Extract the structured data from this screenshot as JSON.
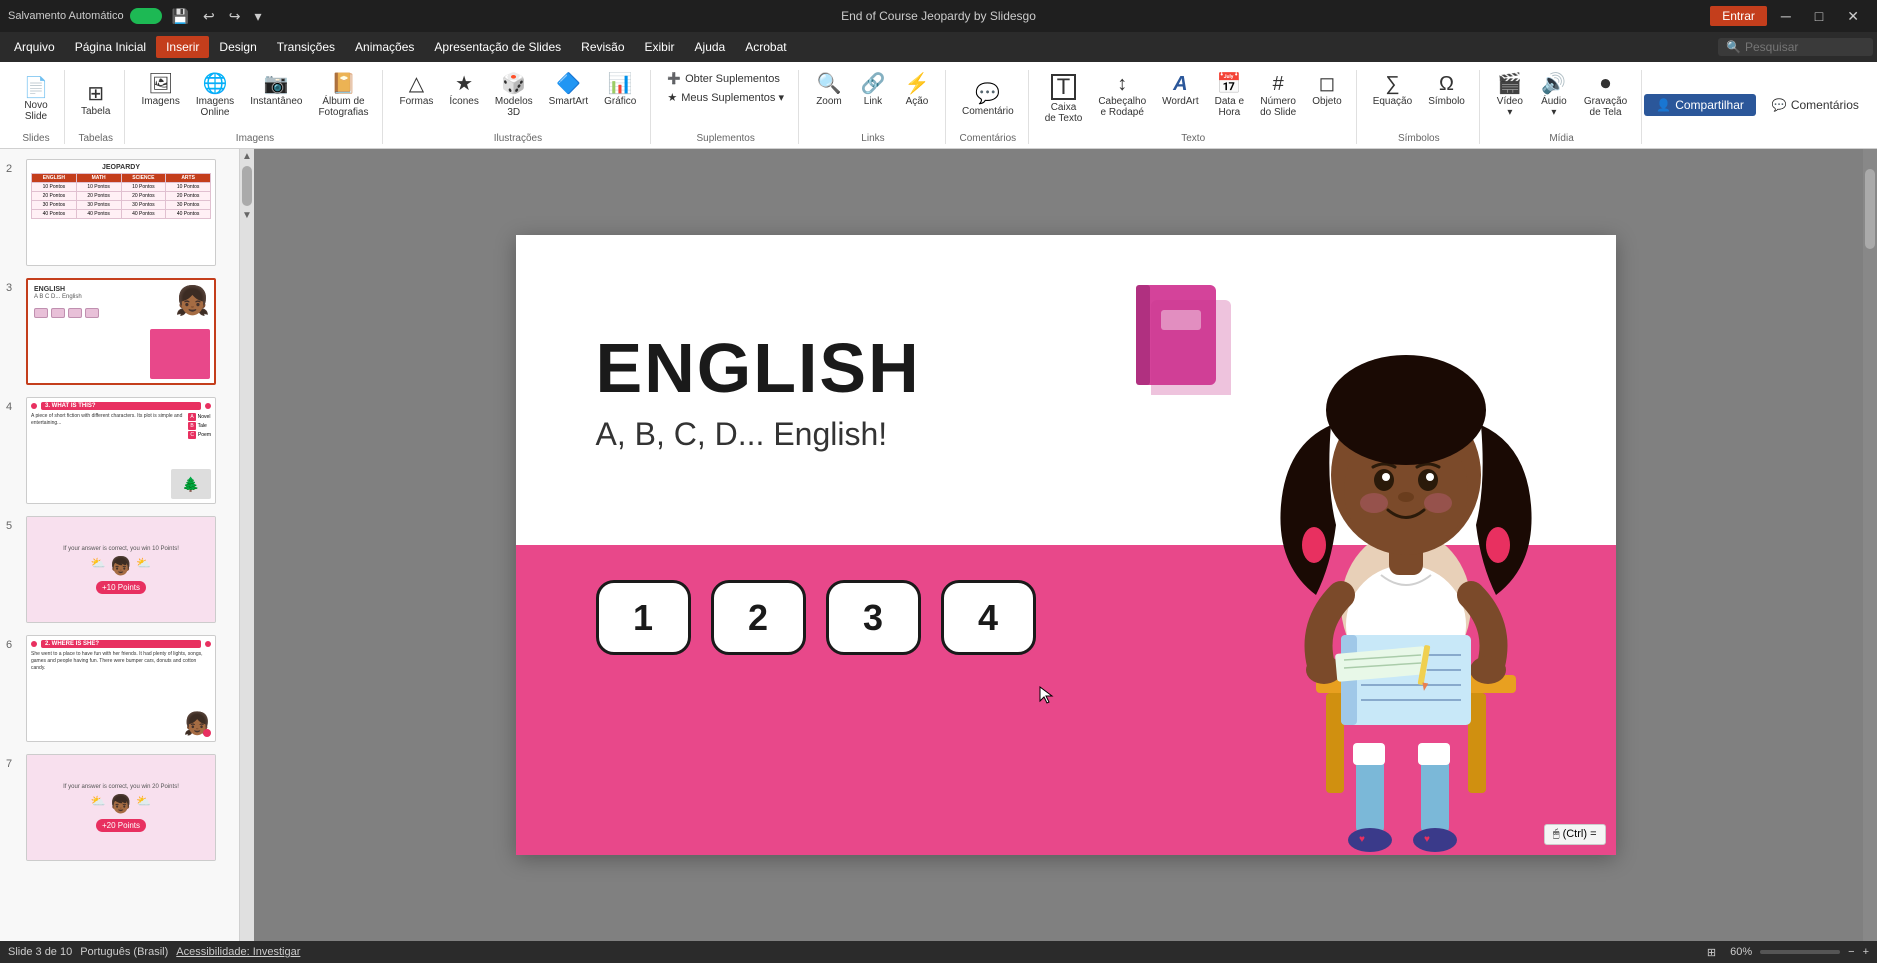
{
  "titlebar": {
    "autosave": "Salvamento Automático",
    "title": "End of Course Jeopardy by Slidesgo",
    "entrar": "Entrar",
    "icons": {
      "save": "💾",
      "undo": "↩",
      "redo": "↪",
      "customize": "⚙"
    },
    "win_min": "─",
    "win_max": "□",
    "win_close": "✕"
  },
  "menubar": {
    "items": [
      "Arquivo",
      "Página Inicial",
      "Inserir",
      "Design",
      "Transições",
      "Animações",
      "Apresentação de Slides",
      "Revisão",
      "Exibir",
      "Ajuda",
      "Acrobat"
    ],
    "active": "Inserir",
    "search_placeholder": "Pesquisar"
  },
  "ribbon": {
    "groups": [
      {
        "name": "Slides",
        "label": "Slides",
        "items": [
          {
            "label": "Novo\nSlide",
            "icon": "📄"
          }
        ]
      },
      {
        "name": "Tabelas",
        "label": "Tabelas",
        "items": [
          {
            "label": "Tabela",
            "icon": "⊞"
          }
        ]
      },
      {
        "name": "Imagens",
        "label": "Imagens",
        "items": [
          {
            "label": "Imagens",
            "icon": "🖼"
          },
          {
            "label": "Imagens\nOnline",
            "icon": "🌐"
          },
          {
            "label": "Instantâneo",
            "icon": "📷"
          },
          {
            "label": "Álbum de\nFotografias",
            "icon": "📔"
          }
        ]
      },
      {
        "name": "Ilustrações",
        "label": "Ilustrações",
        "items": [
          {
            "label": "Formas",
            "icon": "△"
          },
          {
            "label": "Ícones",
            "icon": "★"
          },
          {
            "label": "Modelos\n3D",
            "icon": "🎲"
          },
          {
            "label": "SmartArt",
            "icon": "🔷"
          },
          {
            "label": "Gráfico",
            "icon": "📊"
          }
        ]
      },
      {
        "name": "Suplementos",
        "label": "Suplementos",
        "items": [
          {
            "label": "Obter Suplementos",
            "icon": "➕"
          },
          {
            "label": "Meus Suplementos",
            "icon": "🔽"
          }
        ]
      },
      {
        "name": "Links",
        "label": "Links",
        "items": [
          {
            "label": "Zoom",
            "icon": "🔍"
          },
          {
            "label": "Link",
            "icon": "🔗"
          },
          {
            "label": "Ação",
            "icon": "▶"
          }
        ]
      },
      {
        "name": "Comentários",
        "label": "Comentários",
        "items": [
          {
            "label": "Comentário",
            "icon": "💬"
          }
        ]
      },
      {
        "name": "Texto",
        "label": "Texto",
        "items": [
          {
            "label": "Caixa\nde Texto",
            "icon": "T"
          },
          {
            "label": "Cabeçalho\ne Rodapé",
            "icon": "↕"
          },
          {
            "label": "WordArt",
            "icon": "A"
          },
          {
            "label": "Data e\nHora",
            "icon": "📅"
          },
          {
            "label": "Número\ndo Slide",
            "icon": "#"
          },
          {
            "label": "Objeto",
            "icon": "◻"
          }
        ]
      },
      {
        "name": "Símbolos",
        "label": "Símbolos",
        "items": [
          {
            "label": "Equação",
            "icon": "∑"
          },
          {
            "label": "Símbolo",
            "icon": "Ω"
          }
        ]
      },
      {
        "name": "Mídia",
        "label": "Mídia",
        "items": [
          {
            "label": "Vídeo",
            "icon": "🎬"
          },
          {
            "label": "Áudio",
            "icon": "🔊"
          },
          {
            "label": "Gravação\nde Tela",
            "icon": "⏺"
          }
        ]
      }
    ],
    "share_label": "Compartilhar",
    "comments_label": "Comentários",
    "collapse_icon": "▲"
  },
  "slides": [
    {
      "num": 2,
      "type": "jeopardy"
    },
    {
      "num": 3,
      "type": "english",
      "active": true
    },
    {
      "num": 4,
      "type": "what_is_this"
    },
    {
      "num": 5,
      "type": "clouds"
    },
    {
      "num": 6,
      "type": "where_is_she"
    },
    {
      "num": 7,
      "type": "points"
    }
  ],
  "current_slide": {
    "title": "ENGLISH",
    "subtitle": "A, B, C, D... English!",
    "answer_buttons": [
      "1",
      "2",
      "3",
      "4"
    ],
    "book_icon": "📕"
  },
  "statusbar": {
    "slide_info": "Slide 3 de 10",
    "language": "Português (Brasil)",
    "accessibility": "Acessibilidade: Investigar",
    "zoom": "60%",
    "fit_btn": "⊞",
    "ctrl_hint": "🖱 (Ctrl) ="
  }
}
